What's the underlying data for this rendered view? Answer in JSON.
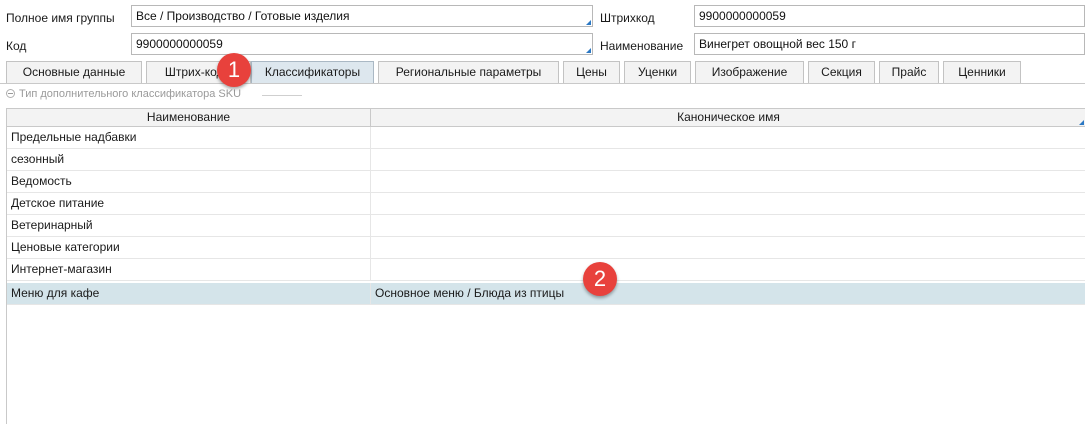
{
  "form": {
    "group_label": "Полное имя группы",
    "group_value": "Все / Производство / Готовые изделия",
    "barcode_label": "Штрихкод",
    "barcode_value": "9900000000059",
    "code_label": "Код",
    "code_value": "9900000000059",
    "name_label": "Наименование",
    "name_value": "Винегрет овощной вес 150 г"
  },
  "tabs": [
    {
      "label": "Основные данные"
    },
    {
      "label": "Штрих-коды"
    },
    {
      "label": "Классификаторы",
      "active": true
    },
    {
      "label": "Региональные параметры"
    },
    {
      "label": "Цены"
    },
    {
      "label": "Уценки"
    },
    {
      "label": "Изображение"
    },
    {
      "label": "Секция"
    },
    {
      "label": "Прайс"
    },
    {
      "label": "Ценники"
    }
  ],
  "section": {
    "title": "Тип дополнительного классификатора SKU"
  },
  "grid": {
    "columns": [
      "Наименование",
      "Каноническое имя"
    ],
    "rows": [
      {
        "name": "Предельные надбавки",
        "canonical": ""
      },
      {
        "name": "сезонный",
        "canonical": ""
      },
      {
        "name": "Ведомость",
        "canonical": ""
      },
      {
        "name": "Детское питание",
        "canonical": ""
      },
      {
        "name": "Ветеринарный",
        "canonical": ""
      },
      {
        "name": "Ценовые категории",
        "canonical": ""
      },
      {
        "name": "Интернет-магазин",
        "canonical": ""
      },
      {
        "name": "Меню для кафе",
        "canonical": "Основное меню / Блюда из птицы",
        "selected": true
      }
    ]
  },
  "annotations": {
    "badge1": "1",
    "badge2": "2"
  },
  "colors": {
    "accent": "#2b78c4",
    "selected_row": "#d4e4ea",
    "badge": "#e8413c"
  }
}
